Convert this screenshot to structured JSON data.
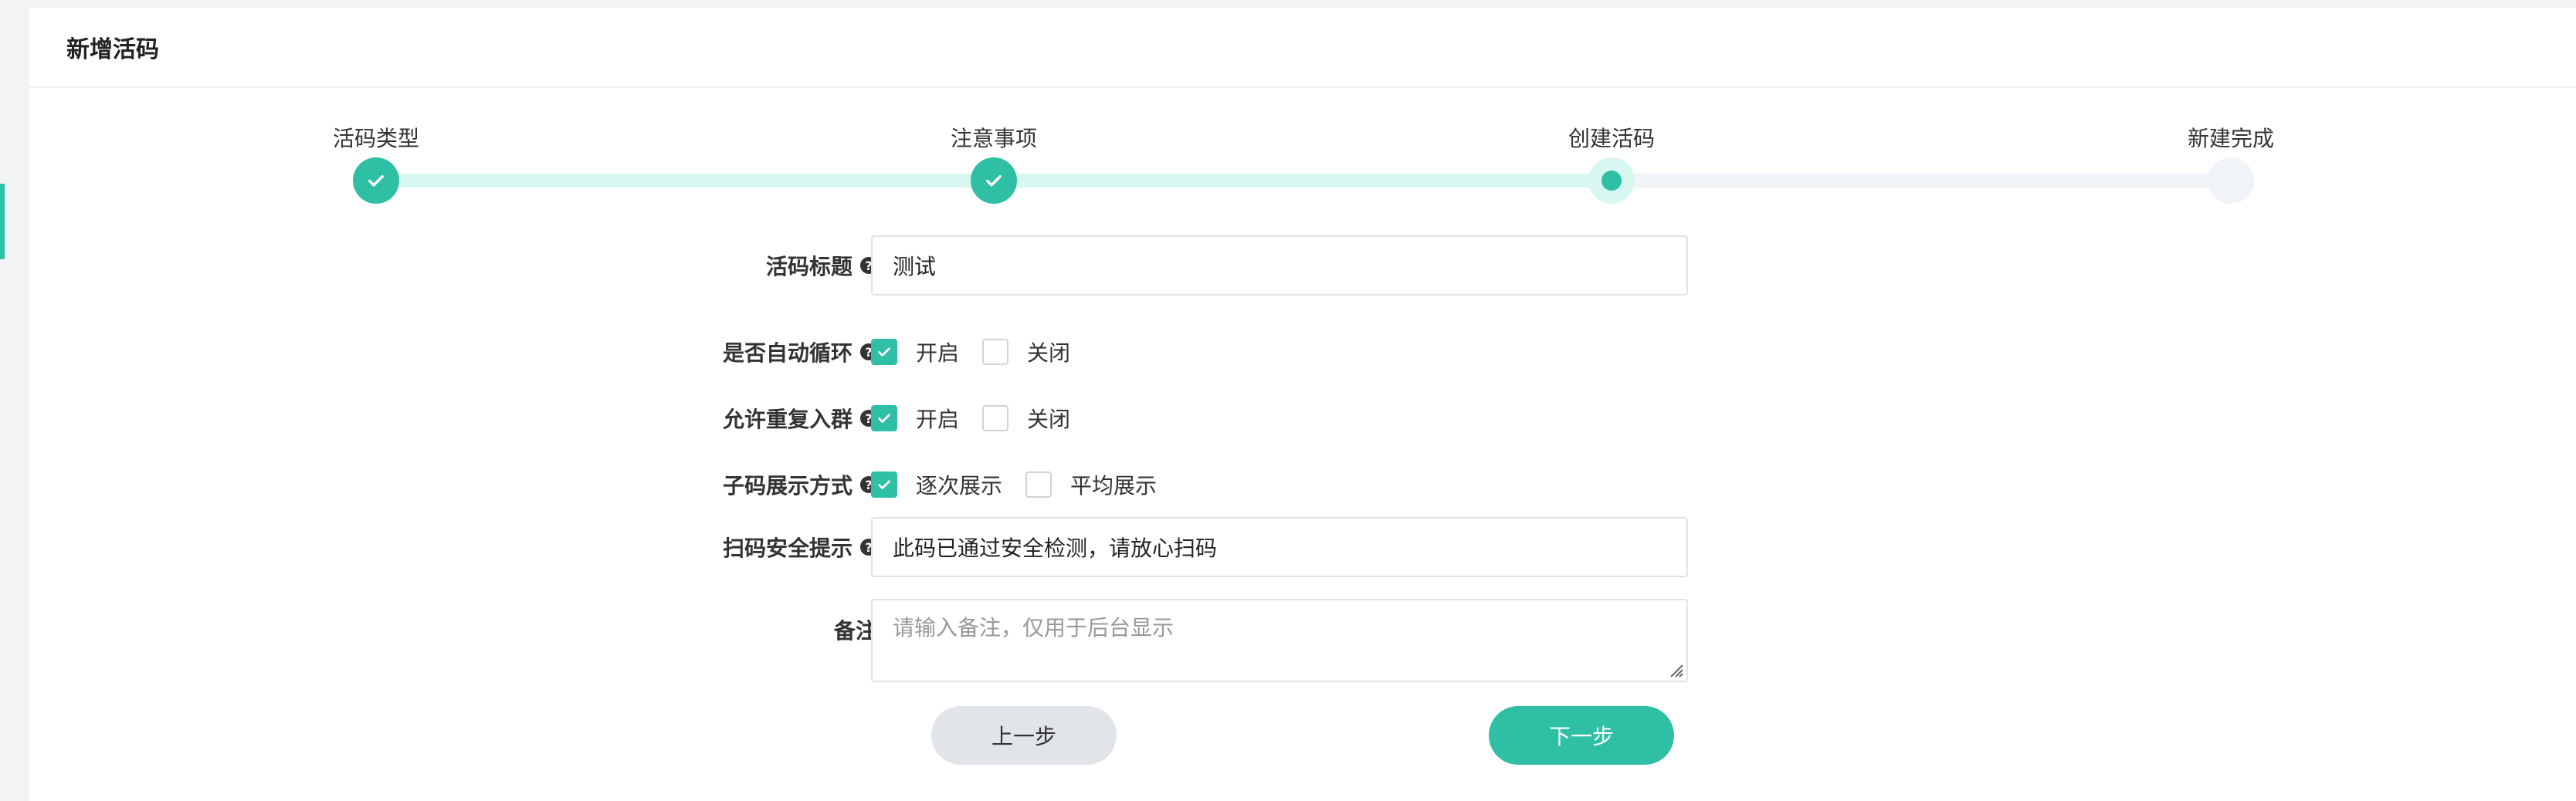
{
  "page": {
    "title": "新增活码"
  },
  "steps": [
    {
      "label": "活码类型",
      "state": "done"
    },
    {
      "label": "注意事项",
      "state": "done"
    },
    {
      "label": "创建活码",
      "state": "current"
    },
    {
      "label": "新建完成",
      "state": "todo"
    }
  ],
  "form": {
    "title": {
      "label": "活码标题",
      "value": "测试"
    },
    "auto_loop": {
      "label": "是否自动循环",
      "options": [
        {
          "label": "开启",
          "checked": true
        },
        {
          "label": "关闭",
          "checked": false
        }
      ]
    },
    "rejoin": {
      "label": "允许重复入群",
      "options": [
        {
          "label": "开启",
          "checked": true
        },
        {
          "label": "关闭",
          "checked": false
        }
      ]
    },
    "display_mode": {
      "label": "子码展示方式",
      "options": [
        {
          "label": "逐次展示",
          "checked": true
        },
        {
          "label": "平均展示",
          "checked": false
        }
      ]
    },
    "security_tip": {
      "label": "扫码安全提示",
      "value": "此码已通过安全检测，请放心扫码"
    },
    "remark": {
      "label": "备注",
      "placeholder": "请输入备注，仅用于后台显示"
    }
  },
  "buttons": {
    "prev": "上一步",
    "next": "下一步"
  },
  "colors": {
    "accent": "#2ebfa5",
    "accent_light": "#d9f7f1"
  }
}
